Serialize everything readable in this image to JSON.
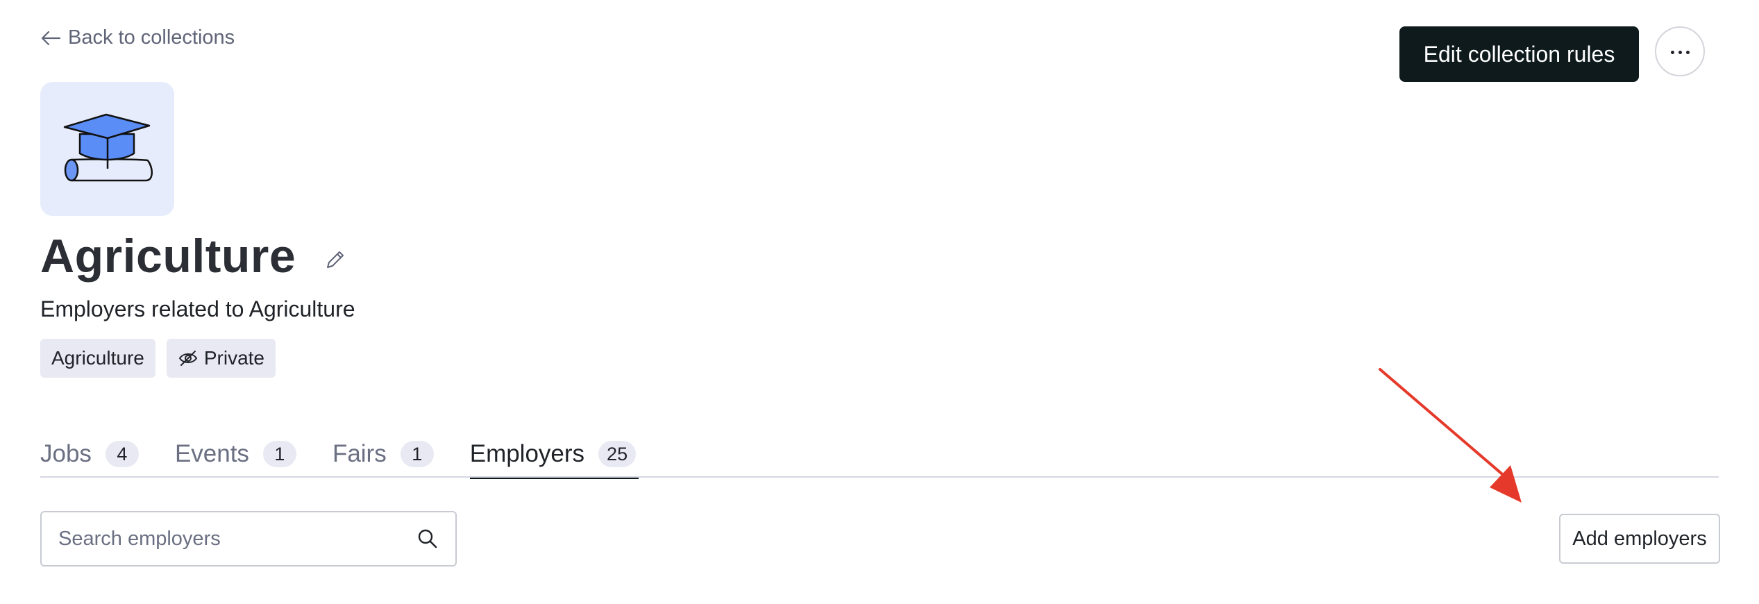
{
  "nav": {
    "back_label": "Back to collections",
    "back_icon": "arrow-left-icon"
  },
  "actions": {
    "edit_label": "Edit collection rules",
    "more_icon": "more-horizontal-icon"
  },
  "collection": {
    "image_icon": "graduation-cap-diploma-icon",
    "title": "Agriculture",
    "edit_icon": "pencil-icon",
    "description": "Employers related to Agriculture",
    "tags": [
      {
        "label": "Agriculture",
        "icon": null
      },
      {
        "label": "Private",
        "icon": "eye-off-icon"
      }
    ]
  },
  "tabs": [
    {
      "label": "Jobs",
      "count": "4",
      "active": false
    },
    {
      "label": "Events",
      "count": "1",
      "active": false
    },
    {
      "label": "Fairs",
      "count": "1",
      "active": false
    },
    {
      "label": "Employers",
      "count": "25",
      "active": true
    }
  ],
  "search": {
    "placeholder": "Search employers",
    "icon": "search-icon"
  },
  "add_employers_label": "Add employers",
  "colors": {
    "primary_button": "#0f1a1c",
    "image_bg": "#e6ecfb",
    "cap_blue": "#5b8df6",
    "tag_bg": "#e8e9f2",
    "annotation_arrow": "#e53a2b"
  }
}
